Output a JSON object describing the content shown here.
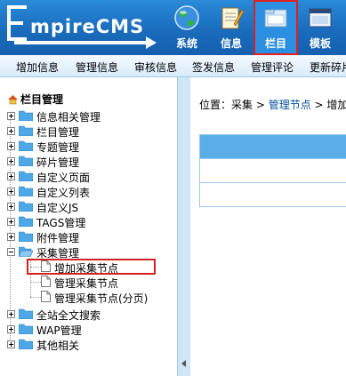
{
  "logo": {
    "e": "E",
    "text": "mpireCMS"
  },
  "topnav": [
    {
      "label": "系统",
      "icon": "globe-icon"
    },
    {
      "label": "信息",
      "icon": "notepad-icon"
    },
    {
      "label": "栏目",
      "icon": "folder-icon",
      "active": true
    },
    {
      "label": "模板",
      "icon": "window-icon"
    }
  ],
  "subnav": [
    "增加信息",
    "管理信息",
    "审核信息",
    "签发信息",
    "管理评论",
    "更新碎片"
  ],
  "tree": {
    "title": "栏目管理",
    "nodes": [
      "信息相关管理",
      "栏目管理",
      "专题管理",
      "碎片管理",
      "自定义页面",
      "自定义列表",
      "自定义JS",
      "TAGS管理",
      "附件管理",
      "采集管理"
    ],
    "children": [
      "增加采集节点",
      "管理采集节点",
      "管理采集节点(分页)"
    ],
    "after": [
      "全站全文搜索",
      "WAP管理",
      "其他相关"
    ]
  },
  "breadcrumb": {
    "prefix": "位置：采集 > ",
    "link": "管理节点",
    "sep": " > ",
    "current": "增加"
  },
  "colors": {
    "header": "#1a6cbd",
    "highlight": "#d42020",
    "link": "#004fa0"
  }
}
